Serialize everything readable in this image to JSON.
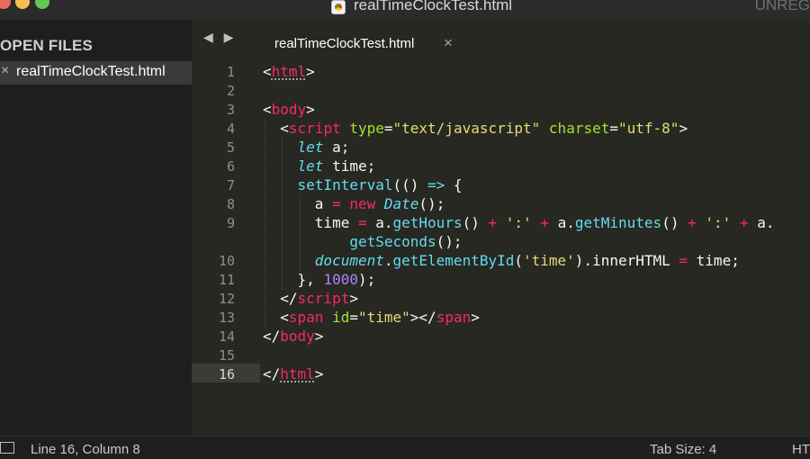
{
  "window": {
    "title": "realTimeClockTest.html",
    "registration": "UNREG"
  },
  "sidebar": {
    "section_title": "OPEN FILES",
    "files": [
      {
        "close": "×",
        "name": "realTimeClockTest.html"
      }
    ]
  },
  "tabbar": {
    "nav": "◀ ▶",
    "tabs": [
      {
        "label": "realTimeClockTest.html",
        "close": "×"
      }
    ]
  },
  "editor": {
    "line_numbers": [
      "1",
      "2",
      "3",
      "4",
      "5",
      "6",
      "7",
      "8",
      "9",
      "",
      "10",
      "11",
      "12",
      "13",
      "14",
      "15",
      "16"
    ],
    "current_line": "16",
    "code": {
      "l1_open": "<",
      "l1_tag": "html",
      "l1_close": ">",
      "l3_open": "<",
      "l3_tag": "body",
      "l3_close": ">",
      "l4_open": "<",
      "l4_tag": "script",
      "l4_attr1": "type",
      "l4_eq1": "=",
      "l4_val1": "\"text/javascript\"",
      "l4_attr2": "charset",
      "l4_eq2": "=",
      "l4_val2": "\"utf-8\"",
      "l4_close": ">",
      "l5_kw": "let",
      "l5_rest": " a;",
      "l6_kw": "let",
      "l6_rest": " time;",
      "l7_fn": "setInterval",
      "l7_p1": "(() ",
      "l7_arrow": "=>",
      "l7_p2": " {",
      "l8_a": "a ",
      "l8_eq": "=",
      "l8_sp": " ",
      "l8_new": "new",
      "l8_sp2": " ",
      "l8_cls": "Date",
      "l8_end": "();",
      "l9_a": "time ",
      "l9_eq": "=",
      "l9_b": " a.",
      "l9_fn1": "getHours",
      "l9_c": "() ",
      "l9_plus1": "+",
      "l9_sp1": " ",
      "l9_s1": "':'",
      "l9_sp2": " ",
      "l9_plus2": "+",
      "l9_d": " a.",
      "l9_fn2": "getMinutes",
      "l9_e": "() ",
      "l9_plus3": "+",
      "l9_sp3": " ",
      "l9_s2": "':'",
      "l9_sp4": " ",
      "l9_plus4": "+",
      "l9_f": " a.",
      "l9w_fn": "getSeconds",
      "l9w_end": "();",
      "l10_doc": "document",
      "l10_dot": ".",
      "l10_fn": "getElementById",
      "l10_p": "(",
      "l10_s": "'time'",
      "l10_q": ").innerHTML ",
      "l10_eq": "=",
      "l10_end": " time;",
      "l11_a": "}, ",
      "l11_num": "1000",
      "l11_end": ");",
      "l12_open": "</",
      "l12_tag": "script",
      "l12_close": ">",
      "l13_open": "<",
      "l13_tag": "span",
      "l13_attr": "id",
      "l13_eq": "=",
      "l13_val": "\"time\"",
      "l13_mid": "></",
      "l13_tag2": "span",
      "l13_close": ">",
      "l14_open": "</",
      "l14_tag": "body",
      "l14_close": ">",
      "l16_open": "</",
      "l16_tag": "html",
      "l16_close": ">"
    }
  },
  "statusbar": {
    "position": "Line 16, Column 8",
    "tab_size": "Tab Size: 4",
    "syntax": "HTML"
  },
  "colors": {
    "background": "#272822",
    "tag": "#f92672",
    "attribute": "#a6e22e",
    "string": "#e6db74",
    "keyword": "#66d9ef",
    "number": "#ae81ff"
  }
}
